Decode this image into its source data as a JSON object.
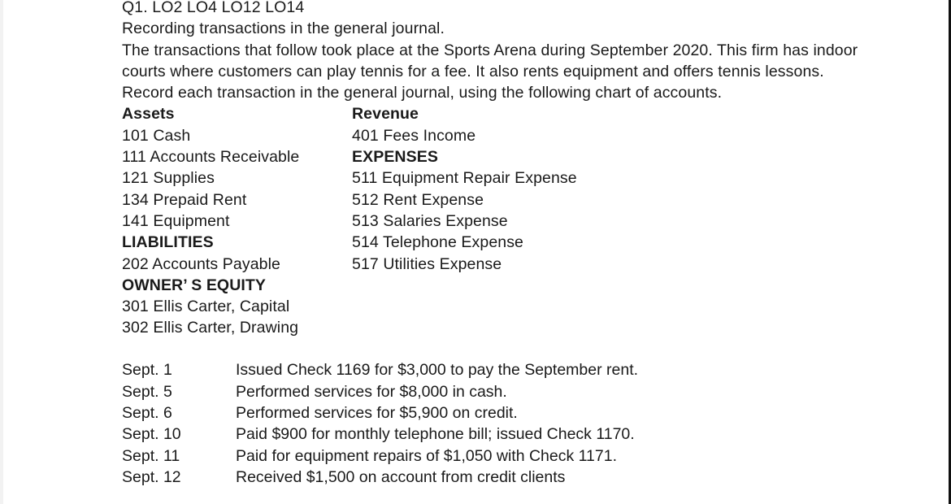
{
  "header": {
    "question": "Q1. LO2 LO4 LO12 LO14",
    "title": "Recording transactions in the general journal.",
    "intro_lines": [
      "The transactions that follow took place at the Sports Arena during September 2020. This firm has indoor",
      "courts where customers can play tennis for a fee. It also rents equipment and offers tennis lessons.",
      "Record each transaction in the general journal, using the following chart of accounts."
    ]
  },
  "chart_of_accounts": {
    "left": [
      {
        "text": "Assets",
        "heading": true
      },
      {
        "text": "101 Cash",
        "heading": false
      },
      {
        "text": "111 Accounts Receivable",
        "heading": false
      },
      {
        "text": "121 Supplies",
        "heading": false
      },
      {
        "text": "134 Prepaid Rent",
        "heading": false
      },
      {
        "text": "141 Equipment",
        "heading": false
      },
      {
        "text": "LIABILITIES",
        "heading": true
      },
      {
        "text": "202 Accounts Payable",
        "heading": false
      },
      {
        "text": "OWNER’ S EQUITY",
        "heading": true
      },
      {
        "text": "301 Ellis Carter, Capital",
        "heading": false
      },
      {
        "text": "302 Ellis Carter, Drawing",
        "heading": false
      }
    ],
    "right": [
      {
        "text": "Revenue",
        "heading": true
      },
      {
        "text": "401 Fees Income",
        "heading": false
      },
      {
        "text": "EXPENSES",
        "heading": true
      },
      {
        "text": "511 Equipment Repair Expense",
        "heading": false
      },
      {
        "text": "512 Rent Expense",
        "heading": false
      },
      {
        "text": "513 Salaries Expense",
        "heading": false
      },
      {
        "text": "514 Telephone Expense",
        "heading": false
      },
      {
        "text": "517 Utilities Expense",
        "heading": false
      }
    ]
  },
  "transactions": [
    {
      "date": "Sept. 1",
      "description": "Issued Check 1169 for $3,000 to pay the September rent."
    },
    {
      "date": "Sept. 5",
      "description": "Performed services for $8,000 in cash."
    },
    {
      "date": "Sept. 6",
      "description": "Performed services for $5,900 on credit."
    },
    {
      "date": "Sept. 10",
      "description": "Paid $900 for monthly telephone bill; issued Check 1170."
    },
    {
      "date": "Sept. 11",
      "description": "Paid for equipment repairs of $1,050 with Check 1171."
    },
    {
      "date": "Sept. 12",
      "description": "Received $1,500 on account from credit clients"
    }
  ]
}
